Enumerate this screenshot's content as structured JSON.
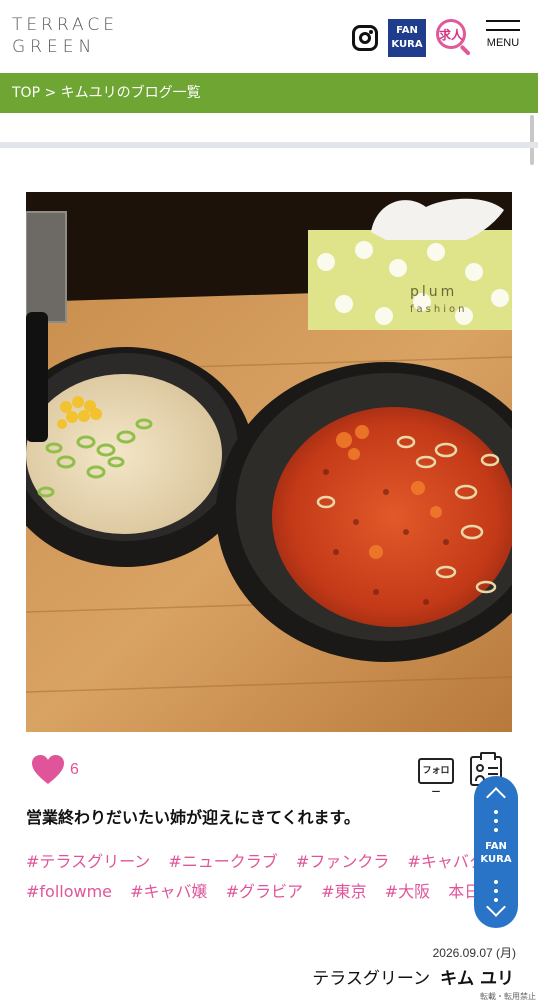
{
  "header": {
    "logo_line1": "TERRACE",
    "logo_line2": "GREEN",
    "fankura_line1": "FAN",
    "fankura_line2": "KURA",
    "job_label": "求人",
    "menu_label": "MENU"
  },
  "breadcrumb": {
    "text": "TOP > キムユリのブログ一覧"
  },
  "post": {
    "like_count": "6",
    "follow_label": "フォロー",
    "title": "営業終わりだいたい姉が迎えにきてくれます。",
    "tags": [
      "#テラスグリーン",
      "#ニュークラブ",
      "#ファンクラ",
      "#キャバクラ",
      "#followme",
      "#キャバ嬢",
      "#グラビア",
      "#東京",
      "#大阪",
      "本日出勤"
    ],
    "date": "2026.09.07 (月)",
    "shop": "テラスグリーン",
    "author": "キム ユリ",
    "copyright": "転載・転用禁止"
  },
  "float_tab": {
    "line1": "FAN",
    "line2": "KURA"
  },
  "photo": {
    "box_text_line1": "plum",
    "box_text_line2": "fashion"
  },
  "colors": {
    "brand_green": "#6fa533",
    "fankura_navy": "#1f3d8c",
    "accent_pink": "#e0559a",
    "float_blue": "#2a74c7"
  }
}
